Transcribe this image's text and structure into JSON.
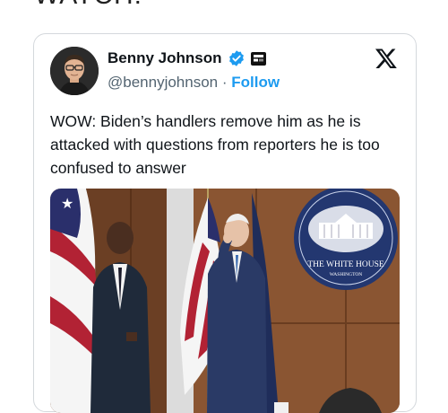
{
  "page": {
    "top_text": "WATCH:"
  },
  "tweet": {
    "author_name": "Benny Johnson",
    "handle": "@bennyjohnson",
    "separator": "·",
    "follow_label": "Follow",
    "text": "WOW: Biden’s handlers remove him as he is attacked with questions from reporters he is too confused to answer",
    "icons": {
      "verified": "verified-badge-icon",
      "affiliate": "affiliate-badge-icon",
      "platform": "x-logo-icon"
    }
  },
  "media": {
    "seal_line1": "THE WHITE HOUSE",
    "seal_line2": "WASHINGTON"
  },
  "colors": {
    "accent": "#1d9bf0",
    "text": "#0f1419",
    "muted": "#536471",
    "border": "#d4d8dc"
  }
}
